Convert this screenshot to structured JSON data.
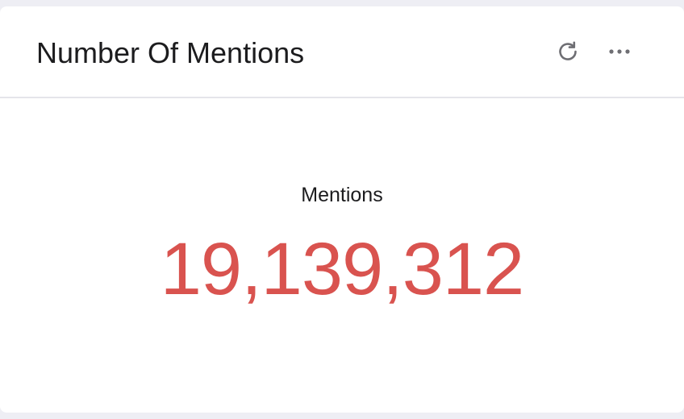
{
  "card": {
    "title": "Number Of Mentions",
    "actions": {
      "refresh_icon": "refresh-icon",
      "more_icon": "more-horizontal-icon"
    },
    "metric": {
      "label": "Mentions",
      "value": "19,139,312",
      "value_color": "#d9534f"
    }
  }
}
